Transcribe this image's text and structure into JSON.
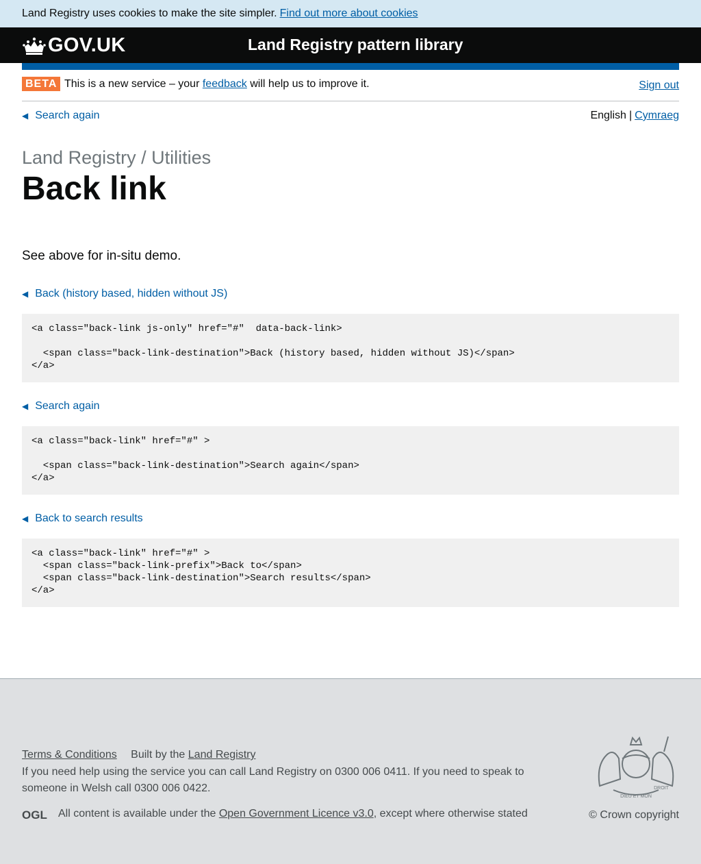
{
  "cookie_banner": {
    "text": "Land Registry uses cookies to make the site simpler.",
    "link": "Find out more about cookies"
  },
  "header": {
    "logotype": "GOV.UK",
    "service_name": "Land Registry pattern library"
  },
  "phase_banner": {
    "tag": "BETA",
    "text_before": "This is a new service – your",
    "feedback_link": "feedback",
    "text_after": "will help us to improve it.",
    "sign_out": "Sign out"
  },
  "top_back_link": "Search again",
  "language": {
    "current": "English",
    "separator": "|",
    "other": "Cymraeg"
  },
  "page": {
    "caption": "Land Registry / Utilities",
    "title": "Back link",
    "intro": "See above for in-situ demo."
  },
  "examples": [
    {
      "link_label": "Back (history based, hidden without JS)",
      "code": "<a class=\"back-link js-only\" href=\"#\"  data-back-link>\n\n  <span class=\"back-link-destination\">Back (history based, hidden without JS)</span>\n</a>"
    },
    {
      "link_label": "Search again",
      "code": "<a class=\"back-link\" href=\"#\" >\n\n  <span class=\"back-link-destination\">Search again</span>\n</a>"
    },
    {
      "link_label": "Back to search results",
      "code": "<a class=\"back-link\" href=\"#\" >\n  <span class=\"back-link-prefix\">Back to</span>\n  <span class=\"back-link-destination\">Search results</span>\n</a>"
    }
  ],
  "footer": {
    "terms": "Terms & Conditions",
    "built_by": "Built by the",
    "built_link": "Land Registry",
    "help_text": "If you need help using the service you can call Land Registry on 0300 006 0411. If you need to speak to someone in Welsh call 0300 006 0422.",
    "licence_before": "All content is available under the",
    "licence_link": "Open Government Licence v3.0",
    "licence_after": ", except where otherwise stated",
    "copyright": "© Crown copyright",
    "ogl_logo": "OGL",
    "crest_text_top": "DIEU ET MON",
    "crest_text_bottom": "DROIT"
  },
  "colors": {
    "link": "#005ea5",
    "header_bg": "#0b0c0c",
    "beta_tag": "#f47738",
    "cookie_bg": "#d5e8f3",
    "code_bg": "#f0f0f0",
    "footer_bg": "#dee0e2"
  },
  "icons": {
    "crown": "crown-icon",
    "back_arrow": "triangle-left-icon",
    "crest": "royal-coat-of-arms"
  }
}
